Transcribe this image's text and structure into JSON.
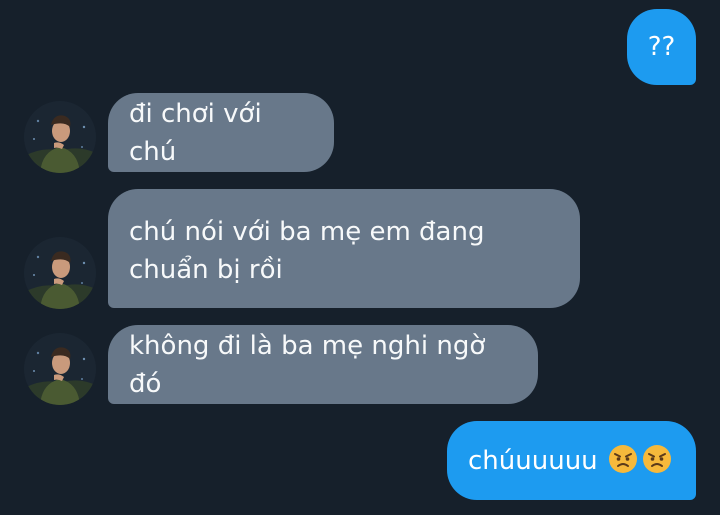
{
  "messages": [
    {
      "id": "m1",
      "direction": "outgoing",
      "text": "??"
    },
    {
      "id": "m2",
      "direction": "incoming",
      "text": "đi chơi với chú"
    },
    {
      "id": "m3",
      "direction": "incoming",
      "text": "chú nói với ba mẹ em đang\nchuẩn bị rồi"
    },
    {
      "id": "m4",
      "direction": "incoming",
      "text": "không đi là ba mẹ nghi ngờ đó"
    },
    {
      "id": "m5",
      "direction": "outgoing",
      "text": "chúuuuuu",
      "emojis": [
        "angry-face-emoji",
        "angry-face-emoji"
      ]
    }
  ],
  "colors": {
    "background": "#16202b",
    "outgoing_bubble": "#1d9bf0",
    "incoming_bubble": "#68788a",
    "text": "#ffffff"
  },
  "icons": {
    "avatar": "contact-avatar-photo",
    "emoji": "angry-face-emoji"
  }
}
